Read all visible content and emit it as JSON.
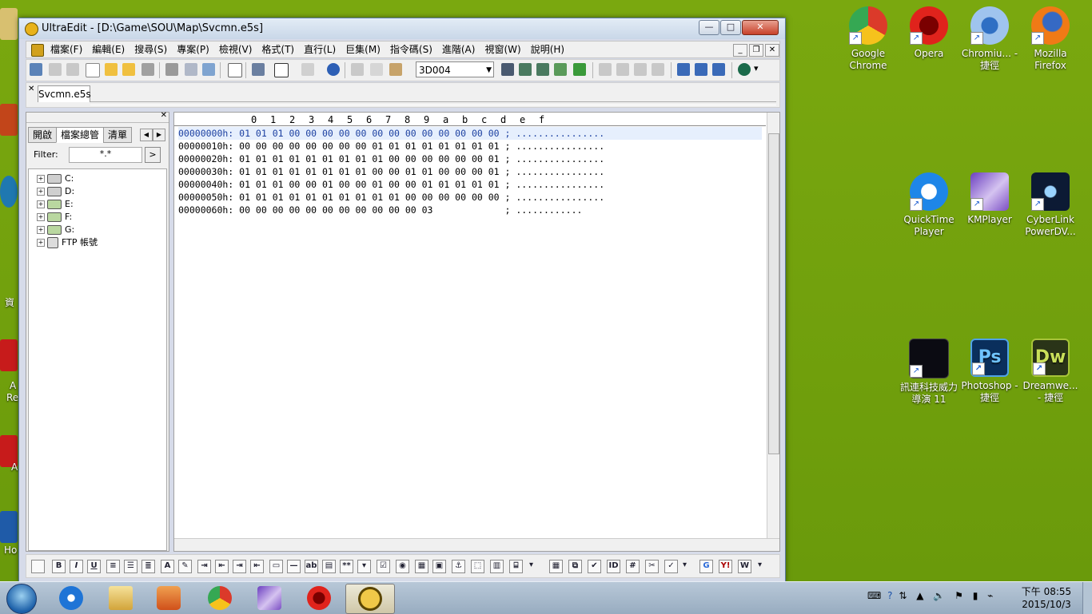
{
  "window": {
    "title": "UltraEdit - [D:\\Game\\SOU\\Map\\Svcmn.e5s]",
    "controls": {
      "minimize": "—",
      "maximize": "□",
      "close": "✕"
    }
  },
  "menu": [
    "檔案(F)",
    "編輯(E)",
    "搜尋(S)",
    "專案(P)",
    "檢視(V)",
    "格式(T)",
    "直行(L)",
    "巨集(M)",
    "指令碼(S)",
    "進階(A)",
    "視窗(W)",
    "說明(H)"
  ],
  "toolbar": {
    "search_combo_value": "3D004"
  },
  "doc_tab": "Svcmn.e5s",
  "file_panel": {
    "tabs": [
      "開啟",
      "檔案總管",
      "清單"
    ],
    "filter_label": "Filter:",
    "filter_value": "*.*",
    "filter_go": ">",
    "tree": [
      {
        "label": "C:",
        "icon": "drive-icon"
      },
      {
        "label": "D:",
        "icon": "drive-icon"
      },
      {
        "label": "E:",
        "icon": "disc-drive-icon"
      },
      {
        "label": "F:",
        "icon": "disc-drive-icon"
      },
      {
        "label": "G:",
        "icon": "disc-drive-icon"
      },
      {
        "label": "FTP 帳號",
        "icon": "ftp-icon"
      }
    ]
  },
  "hex": {
    "columns": [
      "0",
      "1",
      "2",
      "3",
      "4",
      "5",
      "6",
      "7",
      "8",
      "9",
      "a",
      "b",
      "c",
      "d",
      "e",
      "f"
    ],
    "rows": [
      "00000000h: 01 01 01 00 00 00 00 00 00 00 00 00 00 00 00 00 ; ................",
      "00000010h: 00 00 00 00 00 00 00 00 01 01 01 01 01 01 01 01 ; ................",
      "00000020h: 01 01 01 01 01 01 01 01 01 00 00 00 00 00 00 01 ; ................",
      "00000030h: 01 01 01 01 01 01 01 01 00 00 01 01 00 00 00 01 ; ................",
      "00000040h: 01 01 01 00 00 01 00 00 01 00 00 01 01 01 01 01 ; ................",
      "00000050h: 01 01 01 01 01 01 01 01 01 01 00 00 00 00 00 00 ; ................",
      "00000060h: 00 00 00 00 00 00 00 00 00 00 00 03             ; ............"
    ]
  },
  "desktop_icons": [
    {
      "label": "Google Chrome",
      "color": "#e04a2a"
    },
    {
      "label": "Opera",
      "color": "#cc1a1a"
    },
    {
      "label": "Chromiu... - 捷徑",
      "color": "#3a78c8"
    },
    {
      "label": "Mozilla Firefox",
      "color": "#e8731c"
    },
    {
      "label": "QuickTime Player",
      "color": "#1e7ce0"
    },
    {
      "label": "KMPlayer",
      "color": "#7b4ec4"
    },
    {
      "label": "CyberLink PowerDV...",
      "color": "#102040"
    },
    {
      "label": "訊連科技威力導演 11",
      "color": "#101018"
    },
    {
      "label": "Photoshop - 捷徑",
      "color": "#0b3f7a"
    },
    {
      "label": "Dreamwe... - 捷徑",
      "color": "#24301a"
    }
  ],
  "left_edge_texts": [
    "資",
    "A",
    "Re",
    "A",
    "A",
    "Ho"
  ],
  "taskbar": {
    "apps": [
      "ie-icon",
      "explorer-icon",
      "media-player-icon",
      "chrome-icon",
      "kmplayer-icon",
      "opera-icon",
      "ultraedit-icon"
    ],
    "clock_line1": "下午 08:55",
    "clock_line2": "2015/10/3"
  }
}
